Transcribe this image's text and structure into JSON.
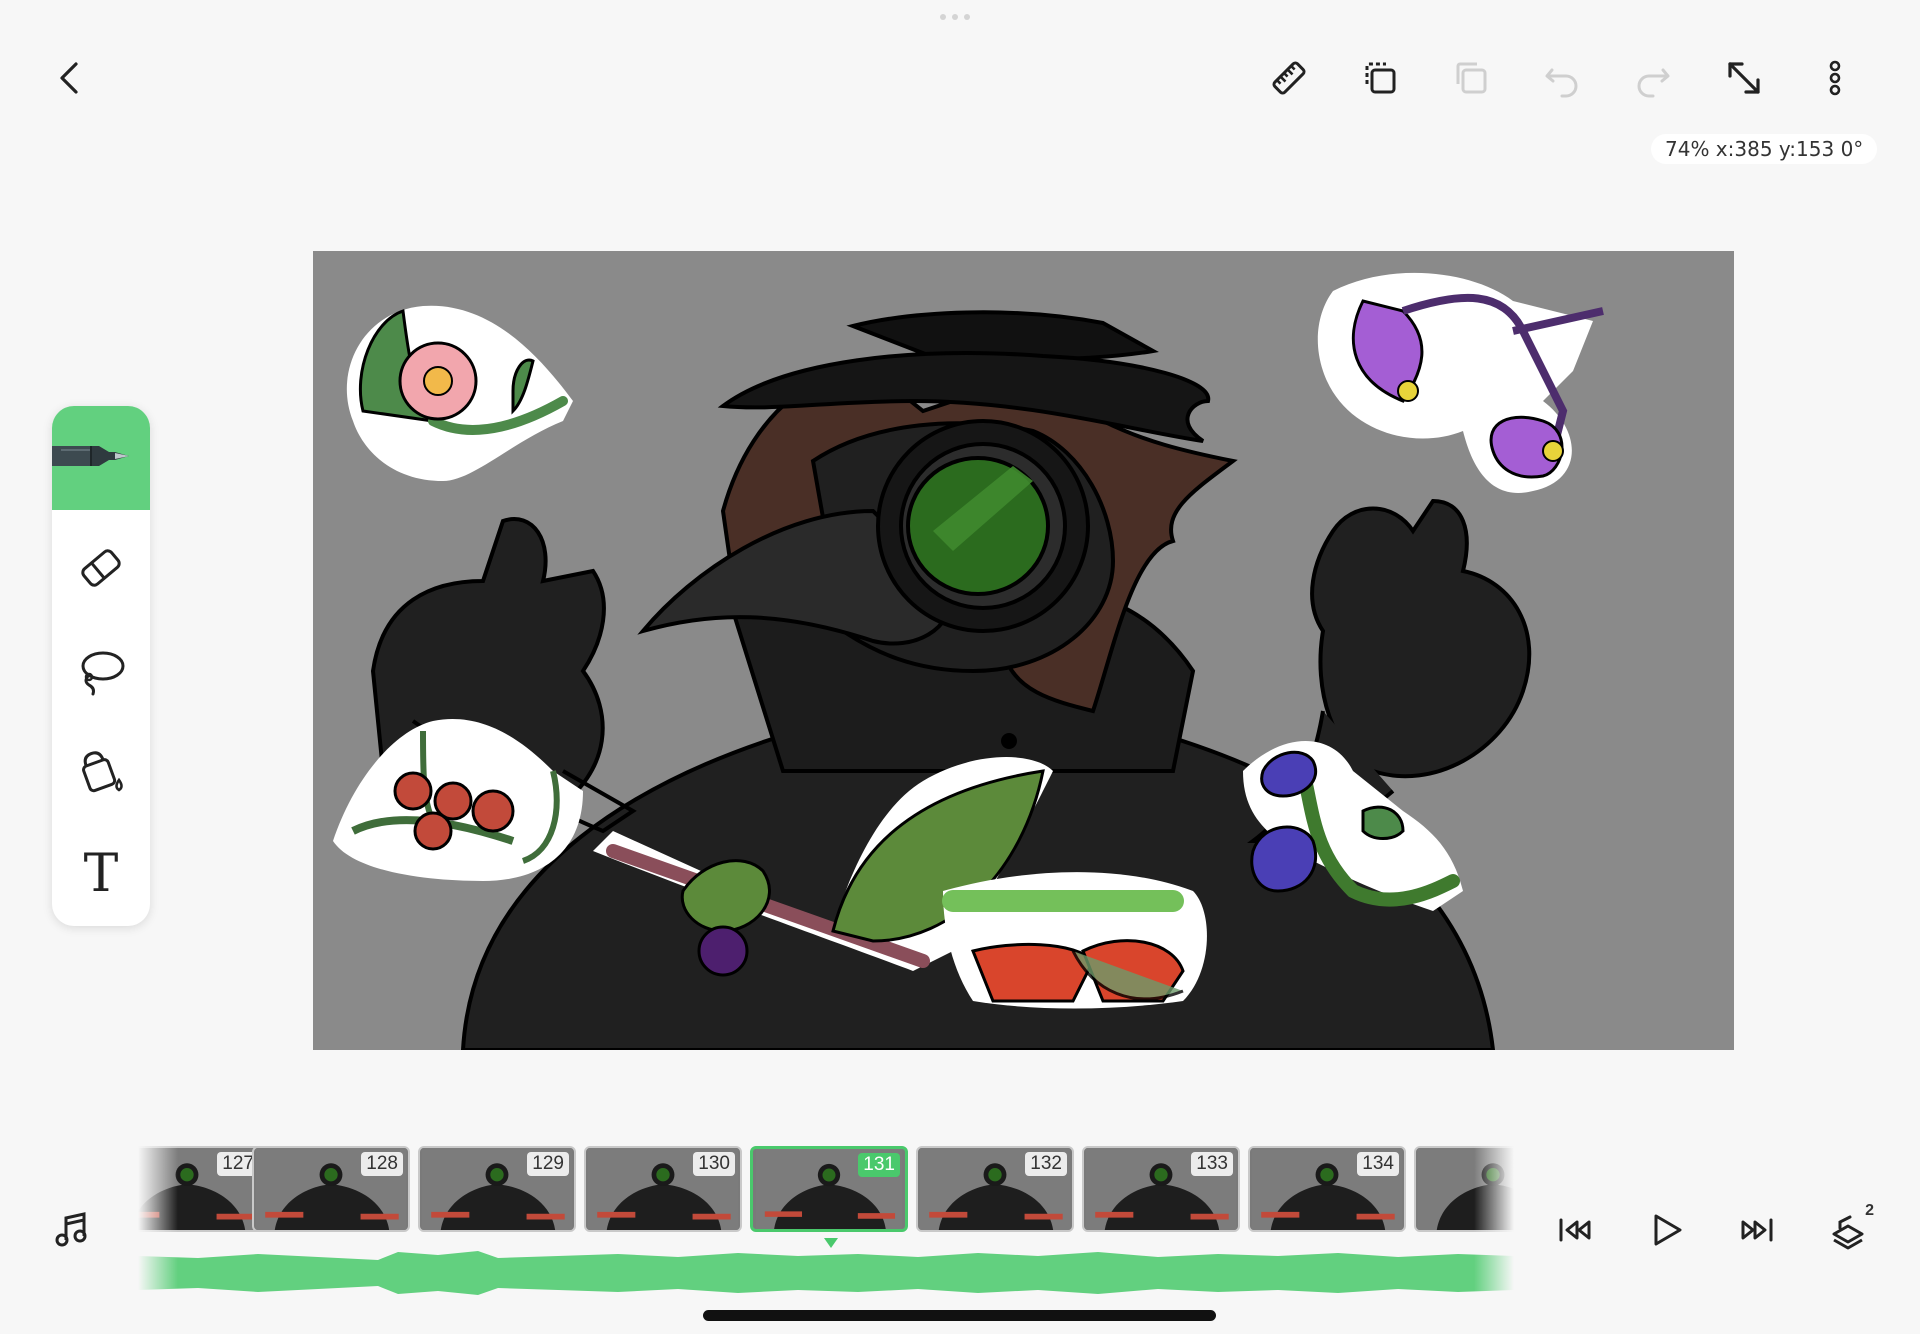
{
  "status": {
    "readout": "74% x:385 y:153 0°"
  },
  "toolbar": {
    "icons": [
      "back-icon",
      "ruler-icon",
      "duplicate-icon",
      "copy-icon",
      "undo-icon",
      "redo-icon",
      "resize-icon",
      "more-icon"
    ]
  },
  "tools": {
    "items": [
      "pen-tool",
      "eraser-tool",
      "lasso-tool",
      "fill-tool",
      "text-tool"
    ],
    "text_glyph": "T",
    "active_color": "#62d07f"
  },
  "timeline": {
    "frames": [
      {
        "number": "127"
      },
      {
        "number": "128"
      },
      {
        "number": "129"
      },
      {
        "number": "130"
      },
      {
        "number": "131"
      },
      {
        "number": "132"
      },
      {
        "number": "133"
      },
      {
        "number": "134"
      },
      {
        "number": ""
      }
    ],
    "current_frame": "131",
    "layers_count": "2",
    "accent": "#4ac96c"
  }
}
